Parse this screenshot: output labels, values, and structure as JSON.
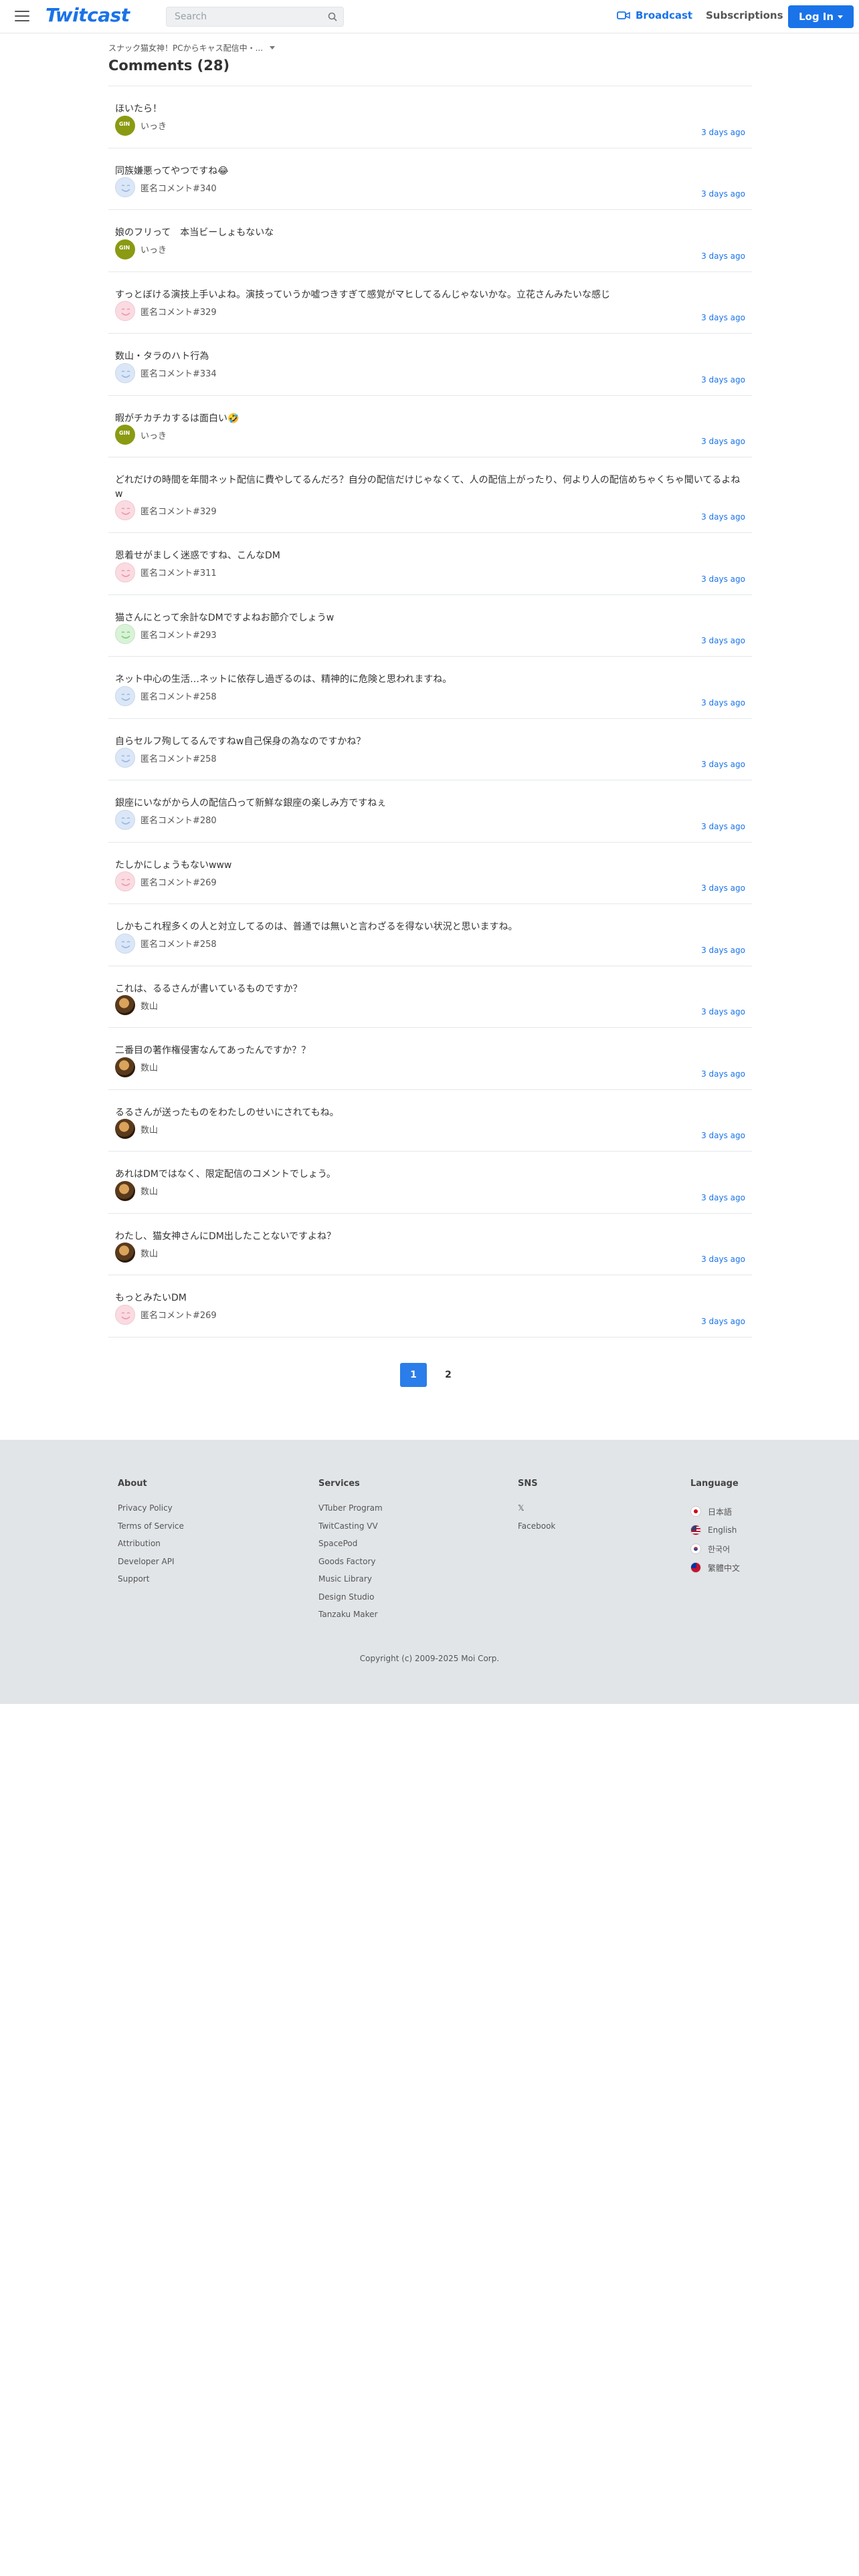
{
  "header": {
    "logo": "Twitcast",
    "search_placeholder": "Search",
    "broadcast_label": "Broadcast",
    "subscriptions_label": "Subscriptions",
    "login_label": "Log In"
  },
  "main": {
    "breadcrumb": "スナック猫女神！PCからキャス配信中・...",
    "title": "Comments (28)",
    "comments": [
      {
        "text": "ほいたら！",
        "user": "いっき",
        "avatar": "olive",
        "time": "3 days ago"
      },
      {
        "text": "同族嫌悪ってやつですね😂",
        "user": "匿名コメント#340",
        "avatar": "blue",
        "time": "3 days ago"
      },
      {
        "text": "娘のフリって　本当ビーしょもないな",
        "user": "いっき",
        "avatar": "olive",
        "time": "3 days ago"
      },
      {
        "text": "すっとぼける演技上手いよね。演技っていうか嘘つきすぎて感覚がマヒしてるんじゃないかな。立花さんみたいな感じ",
        "user": "匿名コメント#329",
        "avatar": "pink",
        "time": "3 days ago"
      },
      {
        "text": "数山・タラのハト行為",
        "user": "匿名コメント#334",
        "avatar": "blue",
        "time": "3 days ago"
      },
      {
        "text": "暇がチカチカするは面白い🤣",
        "user": "いっき",
        "avatar": "olive",
        "time": "3 days ago"
      },
      {
        "text": "どれだけの時間を年間ネット配信に費やしてるんだろ？自分の配信だけじゃなくて、人の配信上がったり、何より人の配信めちゃくちゃ聞いてるよねw",
        "user": "匿名コメント#329",
        "avatar": "pink",
        "time": "3 days ago",
        "tall": true
      },
      {
        "text": "恩着せがましく迷惑ですね、こんなDM",
        "user": "匿名コメント#311",
        "avatar": "pink",
        "time": "3 days ago"
      },
      {
        "text": "猫さんにとって余計なDMですよねお節介でしょうw",
        "user": "匿名コメント#293",
        "avatar": "green",
        "time": "3 days ago"
      },
      {
        "text": "ネット中心の生活…ネットに依存し過ぎるのは、精神的に危険と思われますね。",
        "user": "匿名コメント#258",
        "avatar": "blue",
        "time": "3 days ago"
      },
      {
        "text": "自らセルフ殉してるんですねw自己保身の為なのですかね？",
        "user": "匿名コメント#258",
        "avatar": "blue",
        "time": "3 days ago"
      },
      {
        "text": "銀座にいながから人の配信凸って新鮮な銀座の楽しみ方ですねぇ",
        "user": "匿名コメント#280",
        "avatar": "blue",
        "time": "3 days ago"
      },
      {
        "text": "たしかにしょうもないwww",
        "user": "匿名コメント#269",
        "avatar": "pink",
        "time": "3 days ago"
      },
      {
        "text": "しかもこれ程多くの人と対立してるのは、普通では無いと言わざるを得ない状況と思いますね。",
        "user": "匿名コメント#258",
        "avatar": "blue",
        "time": "3 days ago"
      },
      {
        "text": "これは、るるさんが書いているものですか？",
        "user": "数山",
        "avatar": "photo",
        "time": "3 days ago"
      },
      {
        "text": "二番目の著作権侵害なんてあったんですか？？",
        "user": "数山",
        "avatar": "photo",
        "time": "3 days ago"
      },
      {
        "text": "るるさんが送ったものをわたしのせいにされてもね。",
        "user": "数山",
        "avatar": "photo",
        "time": "3 days ago"
      },
      {
        "text": "あれはDMではなく、限定配信のコメントでしょう。",
        "user": "数山",
        "avatar": "photo",
        "time": "3 days ago"
      },
      {
        "text": "わたし、猫女神さんにDM出したことないですよね？",
        "user": "数山",
        "avatar": "photo",
        "time": "3 days ago"
      },
      {
        "text": "もっとみたいDM",
        "user": "匿名コメント#269",
        "avatar": "pink",
        "time": "3 days ago"
      }
    ]
  },
  "pagination": {
    "pages": [
      "1",
      "2"
    ],
    "active": "1"
  },
  "footer": {
    "about": {
      "title": "About",
      "links": [
        "Privacy Policy",
        "Terms of Service",
        "Attribution",
        "Developer API",
        "Support"
      ]
    },
    "services": {
      "title": "Services",
      "links": [
        "VTuber Program",
        "TwitCasting VV",
        "SpacePod",
        "Goods Factory",
        "Music Library",
        "Design Studio",
        "Tanzaku Maker"
      ]
    },
    "sns": {
      "title": "SNS",
      "links": [
        "𝕏",
        "Facebook"
      ]
    },
    "language": {
      "title": "Language",
      "items": [
        {
          "label": "日本語",
          "flag": "jp"
        },
        {
          "label": "English",
          "flag": "us"
        },
        {
          "label": "한국어",
          "flag": "kr"
        },
        {
          "label": "繁體中文",
          "flag": "tw"
        }
      ]
    },
    "copyright": "Copyright (c) 2009-2025 Moi Corp."
  },
  "colors": {
    "accent": "#1a73e8",
    "footer_bg": "#e2e5e8",
    "time": "#1a73e8"
  }
}
